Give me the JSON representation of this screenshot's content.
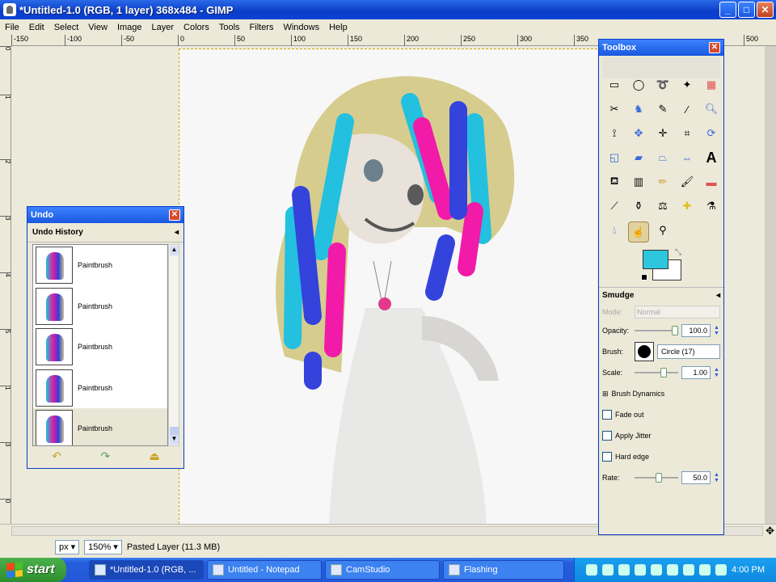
{
  "window": {
    "title": "*Untitled-1.0 (RGB, 1 layer) 368x484 - GIMP"
  },
  "menu": [
    "File",
    "Edit",
    "Select",
    "View",
    "Image",
    "Layer",
    "Colors",
    "Tools",
    "Filters",
    "Windows",
    "Help"
  ],
  "ruler_h": [
    "-150",
    "-100",
    "-50",
    "0",
    "50",
    "100",
    "150",
    "200",
    "250",
    "300",
    "350",
    "500"
  ],
  "ruler_v": [
    "0",
    "1",
    "2",
    "3",
    "0",
    "4",
    "0",
    "5",
    "0",
    "1",
    "2",
    "3",
    "4",
    "0",
    "0"
  ],
  "status": {
    "unit": "px",
    "zoom": "150%",
    "message": "Pasted Layer (11.3 MB)"
  },
  "undo": {
    "title": "Undo",
    "header": "Undo History",
    "items": [
      "Paintbrush",
      "Paintbrush",
      "Paintbrush",
      "Paintbrush",
      "Paintbrush"
    ]
  },
  "toolbox": {
    "title": "Toolbox",
    "fg_color": "#2cc7dd",
    "bg_color": "#ffffff",
    "tools": [
      "rect-select",
      "ellipse-select",
      "free-select",
      "fuzzy-select",
      "color-select",
      "scissors",
      "foreground-select",
      "paths",
      "color-picker",
      "zoom",
      "measure",
      "move",
      "align",
      "crop",
      "rotate",
      "scale",
      "shear",
      "perspective",
      "flip",
      "text",
      "bucket-fill",
      "blend",
      "pencil",
      "paintbrush",
      "eraser",
      "airbrush",
      "ink",
      "clone",
      "heal",
      "perspective-clone",
      "blur",
      "smudge",
      "dodge"
    ],
    "options": {
      "tool_name": "Smudge",
      "mode_label": "Mode:",
      "mode_value": "Normal",
      "opacity_label": "Opacity:",
      "opacity": "100.0",
      "brush_label": "Brush:",
      "brush_name": "Circle (17)",
      "scale_label": "Scale:",
      "scale": "1.00",
      "dynamics_label": "Brush Dynamics",
      "fade_label": "Fade out",
      "jitter_label": "Apply Jitter",
      "hard_label": "Hard edge",
      "rate_label": "Rate:",
      "rate": "50.0"
    }
  },
  "taskbar": {
    "start": "start",
    "tasks": [
      "*Untitled-1.0 (RGB, ...",
      "Untitled - Notepad",
      "CamStudio",
      "Flashing"
    ],
    "time": "4:00 PM"
  }
}
